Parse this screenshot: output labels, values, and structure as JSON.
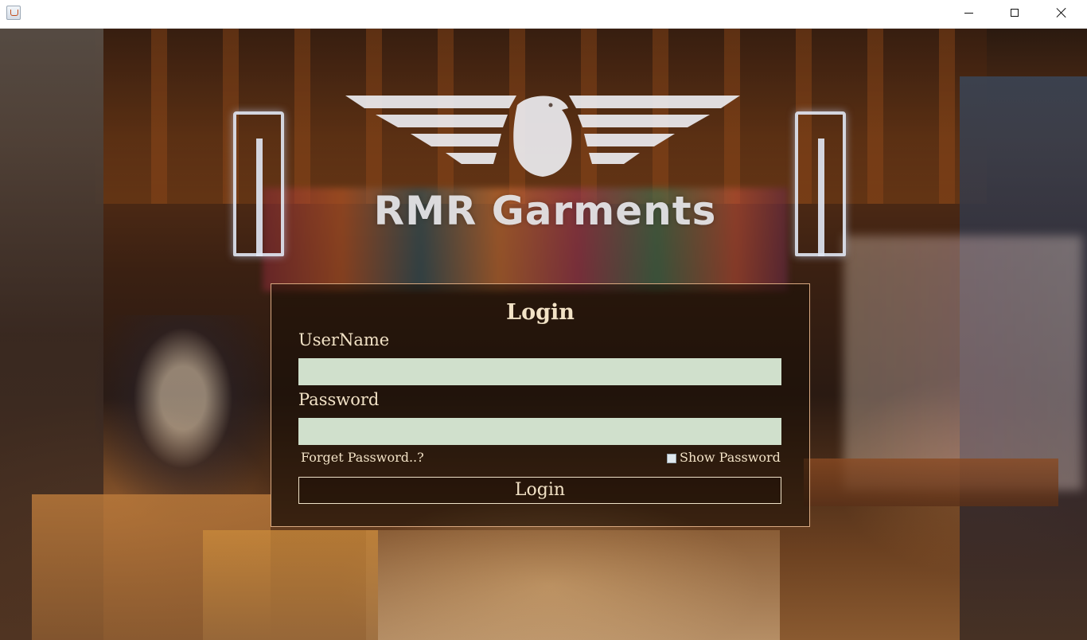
{
  "window": {
    "icon": "java-coffee-cup-icon"
  },
  "brand": {
    "name": "RMR Garments",
    "logo": "eagle-wings-icon"
  },
  "login": {
    "title": "Login",
    "username_label": "UserName",
    "username_value": "",
    "password_label": "Password",
    "password_value": "",
    "forget_password": "Forget Password..?",
    "show_password": "Show Password",
    "show_password_checked": false,
    "button_label": "Login"
  },
  "colors": {
    "field_background": "#d0e0cc",
    "panel_border": "#d8a880",
    "label_text": "#f2e2c6"
  }
}
